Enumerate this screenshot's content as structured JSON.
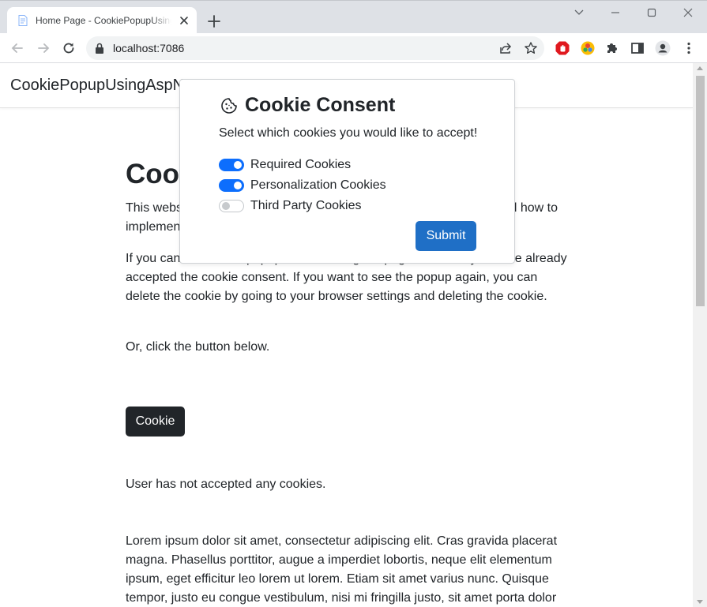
{
  "browser": {
    "tab_title": "Home Page - CookiePopupUsingAspNet",
    "address": "localhost:7086"
  },
  "site": {
    "brand": "CookiePopupUsingAspNet"
  },
  "page": {
    "heading": "Cookie",
    "para1": "This website demonstrates how to create a cookie consent popup and how to implement it.",
    "para2": "If you cannot see the popup when loading the page, it means you have already accepted the cookie consent. If you want to see the popup again, you can delete the cookie by going to your browser settings and deleting the cookie.",
    "para3": "Or, click the button below.",
    "cookie_button": "Cookie",
    "status": "User has not accepted any cookies.",
    "lorem": "Lorem ipsum dolor sit amet, consectetur adipiscing elit. Cras gravida placerat magna. Phasellus porttitor, augue a imperdiet lobortis, neque elit elementum ipsum, eget efficitur leo lorem ut lorem. Etiam sit amet varius nunc. Quisque tempor, justo eu congue vestibulum, nisi mi fringilla justo, sit amet porta dolor"
  },
  "dialog": {
    "title": "Cookie Consent",
    "subtitle": "Select which cookies you would like to accept!",
    "options": [
      {
        "label": "Required Cookies",
        "checked": true
      },
      {
        "label": "Personalization Cookies",
        "checked": true
      },
      {
        "label": "Third Party Cookies",
        "checked": false
      }
    ],
    "submit": "Submit"
  },
  "colors": {
    "switch_on": "#0d6efd",
    "submit_button": "#1f6fc6",
    "dark_button": "#212529"
  },
  "icons": [
    "file-icon",
    "close-icon",
    "plus-icon",
    "chevron-down-icon",
    "minimize-icon",
    "maximize-icon",
    "back-icon",
    "forward-icon",
    "reload-icon",
    "lock-icon",
    "share-icon",
    "star-icon",
    "adblock-icon",
    "color-extension-icon",
    "puzzle-icon",
    "sidepanel-icon",
    "profile-icon",
    "menu-icon",
    "cookie-icon"
  ]
}
